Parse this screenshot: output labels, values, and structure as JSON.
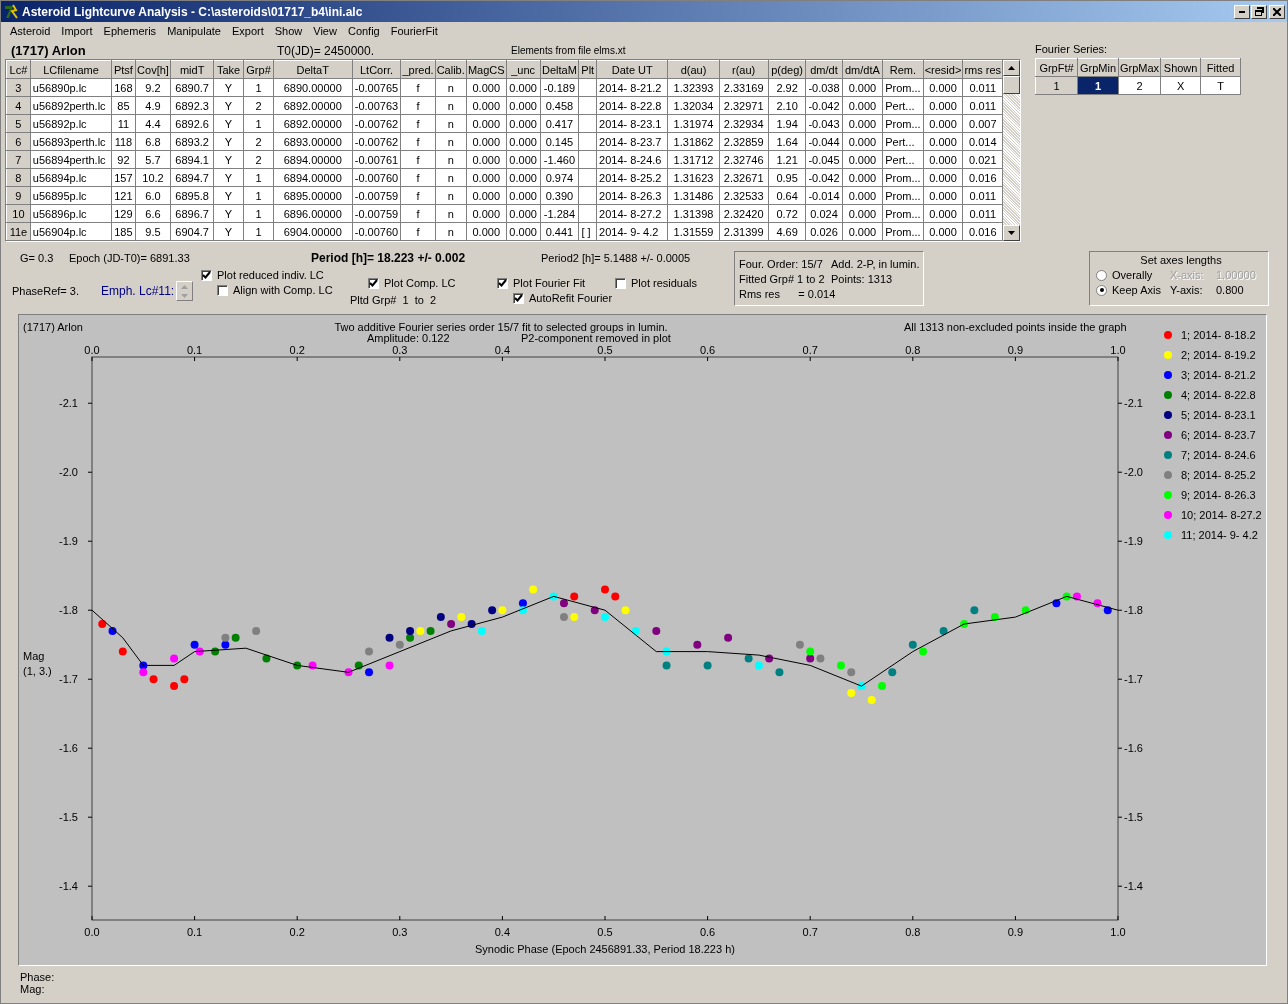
{
  "window": {
    "title": "Asteroid Lightcurve Analysis - C:\\asteroids\\01717_b4\\ini.alc"
  },
  "menu": [
    "Asteroid",
    "Import",
    "Ephemeris",
    "Manipulate",
    "Export",
    "Show",
    "View",
    "Config",
    "FourierFit"
  ],
  "header": {
    "object": "(1717) Arlon",
    "t0": "T0(JD)= 2450000.",
    "elements": "Elements from file elms.xt"
  },
  "lc_table": {
    "columns": [
      "Lc#",
      "LCfilename",
      "Ptsf",
      "Cov[h]",
      "midT",
      "Take",
      "Grp#",
      "DeltaT",
      "LtCorr.",
      "_pred.",
      "Calib.",
      "MagCS",
      "_unc",
      "DeltaM",
      "Plt",
      "Date UT",
      "d(au)",
      "r(au)",
      "p(deg)",
      "dm/dt",
      "dm/dtA",
      "Rem.",
      "<resid>",
      "rms res"
    ],
    "rows": [
      {
        "cells": [
          "3",
          "u56890p.lc",
          "168",
          "9.2",
          "6890.7",
          "Y",
          "1",
          "6890.00000",
          "-0.00765",
          "f",
          "n",
          "0.000",
          "0.000",
          "-0.189",
          "",
          "2014- 8-21.2",
          "1.32393",
          "2.33169",
          "2.92",
          "-0.038",
          "0.000",
          "Prom...",
          "0.000",
          "0.011"
        ]
      },
      {
        "cells": [
          "4",
          "u56892perth.lc",
          "85",
          "4.9",
          "6892.3",
          "Y",
          "2",
          "6892.00000",
          "-0.00763",
          "f",
          "n",
          "0.000",
          "0.000",
          "0.458",
          "",
          "2014- 8-22.8",
          "1.32034",
          "2.32971",
          "2.10",
          "-0.042",
          "0.000",
          "Pert...",
          "0.000",
          "0.011"
        ]
      },
      {
        "cells": [
          "5",
          "u56892p.lc",
          "11",
          "4.4",
          "6892.6",
          "Y",
          "1",
          "6892.00000",
          "-0.00762",
          "f",
          "n",
          "0.000",
          "0.000",
          "0.417",
          "",
          "2014- 8-23.1",
          "1.31974",
          "2.32934",
          "1.94",
          "-0.043",
          "0.000",
          "Prom...",
          "0.000",
          "0.007"
        ]
      },
      {
        "cells": [
          "6",
          "u56893perth.lc",
          "118",
          "6.8",
          "6893.2",
          "Y",
          "2",
          "6893.00000",
          "-0.00762",
          "f",
          "n",
          "0.000",
          "0.000",
          "0.145",
          "",
          "2014- 8-23.7",
          "1.31862",
          "2.32859",
          "1.64",
          "-0.044",
          "0.000",
          "Pert...",
          "0.000",
          "0.014"
        ]
      },
      {
        "cells": [
          "7",
          "u56894perth.lc",
          "92",
          "5.7",
          "6894.1",
          "Y",
          "2",
          "6894.00000",
          "-0.00761",
          "f",
          "n",
          "0.000",
          "0.000",
          "-1.460",
          "",
          "2014- 8-24.6",
          "1.31712",
          "2.32746",
          "1.21",
          "-0.045",
          "0.000",
          "Pert...",
          "0.000",
          "0.021"
        ]
      },
      {
        "cells": [
          "8",
          "u56894p.lc",
          "157",
          "10.2",
          "6894.7",
          "Y",
          "1",
          "6894.00000",
          "-0.00760",
          "f",
          "n",
          "0.000",
          "0.000",
          "0.974",
          "",
          "2014- 8-25.2",
          "1.31623",
          "2.32671",
          "0.95",
          "-0.042",
          "0.000",
          "Prom...",
          "0.000",
          "0.016"
        ]
      },
      {
        "cells": [
          "9",
          "u56895p.lc",
          "121",
          "6.0",
          "6895.8",
          "Y",
          "1",
          "6895.00000",
          "-0.00759",
          "f",
          "n",
          "0.000",
          "0.000",
          "0.390",
          "",
          "2014- 8-26.3",
          "1.31486",
          "2.32533",
          "0.64",
          "-0.014",
          "0.000",
          "Prom...",
          "0.000",
          "0.011"
        ]
      },
      {
        "cells": [
          "10",
          "u56896p.lc",
          "129",
          "6.6",
          "6896.7",
          "Y",
          "1",
          "6896.00000",
          "-0.00759",
          "f",
          "n",
          "0.000",
          "0.000",
          "-1.284",
          "",
          "2014- 8-27.2",
          "1.31398",
          "2.32420",
          "0.72",
          "0.024",
          "0.000",
          "Prom...",
          "0.000",
          "0.011"
        ]
      },
      {
        "cells": [
          "11e",
          "u56904p.lc",
          "185",
          "9.5",
          "6904.7",
          "Y",
          "1",
          "6904.00000",
          "-0.00760",
          "f",
          "n",
          "0.000",
          "0.000",
          "0.441",
          "[ ]",
          "2014- 9- 4.2",
          "1.31559",
          "2.31399",
          "4.69",
          "0.026",
          "0.000",
          "Prom...",
          "0.000",
          "0.016"
        ]
      }
    ]
  },
  "fourier_series": {
    "label": "Fourier Series:",
    "columns": [
      "GrpFt#",
      "GrpMin",
      "GrpMax",
      "Shown",
      "Fitted"
    ],
    "rows": [
      {
        "cells": [
          {
            "text": "1",
            "selected": false
          },
          {
            "text": "1",
            "selected": true
          },
          {
            "text": "2",
            "selected": false
          },
          {
            "text": "X",
            "selected": false
          },
          {
            "text": "T",
            "selected": false
          }
        ]
      }
    ]
  },
  "info": {
    "g": "G= 0.3",
    "epoch": "Epoch (JD-T0)= 6891.33",
    "period": "Period [h]= 18.223 +/- 0.002",
    "period2": "Period2 [h]= 5.1488 +/- 0.0005",
    "phase_ref": "PhaseRef= 3.",
    "emph": "Emph. Lc#11:",
    "pltd_grp": "Pltd Grp#  1  to  2"
  },
  "options": [
    {
      "label": "Plot reduced indiv. LC",
      "checked": true
    },
    {
      "label": "Align with Comp. LC",
      "checked": false
    },
    {
      "label": "Plot Comp. LC",
      "checked": true
    },
    {
      "label": "Plot Fourier Fit",
      "checked": true
    },
    {
      "label": "AutoRefit Fourier",
      "checked": true
    },
    {
      "label": "Plot residuals",
      "checked": false
    }
  ],
  "fit_summary": [
    "Four. Order: 15/7",
    "Add. 2-P, in lumin.",
    "Fitted Grp# 1 to 2",
    "Points: 1313",
    "Rms res      = 0.014"
  ],
  "axes": {
    "title": "Set axes lengths",
    "modes": [
      {
        "label": "Overally",
        "selected": false
      },
      {
        "label": "Keep Axis",
        "selected": true
      }
    ],
    "fields": [
      {
        "label": "X-axis:",
        "value": "1.00000",
        "disabled": true
      },
      {
        "label": "Y-axis:",
        "value": "0.800",
        "disabled": false
      }
    ]
  },
  "plot": {
    "object": "(1717) Arlon",
    "title": "Two additive Fourier series order 15/7 fit to selected groups in lumin.",
    "amplitude": "Amplitude: 0.122",
    "note": "P2-component removed in plot",
    "count": "All 1313 non-excluded points inside the graph",
    "ylabel_sub": "(1, 3.)",
    "top_axis_labels": [
      "0.0",
      "0.1",
      "0.2",
      "0.3",
      "0.4",
      "0.5",
      "0.6",
      "0.7",
      "0.8",
      "0.9",
      "1.0"
    ],
    "right_axis_labels": [
      "-2.1",
      "-2.0",
      "-1.9",
      "-1.8",
      "-1.7",
      "-1.6",
      "-1.5",
      "-1.4"
    ],
    "chart_data": {
      "type": "scatter",
      "legend": "right",
      "xlabel": "Synodic Phase (Epoch 2456891.33, Period 18.223 h)",
      "ylabel": "Mag",
      "xlim": [
        0,
        1
      ],
      "ylim": [
        -1.351,
        -2.167
      ],
      "xticks": [
        {
          "value": 0,
          "label": "0.0"
        },
        {
          "value": 0.1,
          "label": "0.1"
        },
        {
          "value": 0.2,
          "label": "0.2"
        },
        {
          "value": 0.3,
          "label": "0.3"
        },
        {
          "value": 0.4,
          "label": "0.4"
        },
        {
          "value": 0.5,
          "label": "0.5"
        },
        {
          "value": 0.6,
          "label": "0.6"
        },
        {
          "value": 0.7,
          "label": "0.7"
        },
        {
          "value": 0.8,
          "label": "0.8"
        },
        {
          "value": 0.9,
          "label": "0.9"
        },
        {
          "value": 1,
          "label": "1.0"
        }
      ],
      "yticks": [
        {
          "value": -2.1,
          "label": "-2.1"
        },
        {
          "value": -2,
          "label": "-2.0"
        },
        {
          "value": -1.9,
          "label": "-1.9"
        },
        {
          "value": -1.8,
          "label": "-1.8"
        },
        {
          "value": -1.7,
          "label": "-1.7"
        },
        {
          "value": -1.6,
          "label": "-1.6"
        },
        {
          "value": -1.5,
          "label": "-1.5"
        },
        {
          "value": -1.4,
          "label": "-1.4"
        }
      ],
      "series": [
        {
          "name": "1; 2014- 8-18.2",
          "color": "#ff0000",
          "x": [
            0.01,
            0.03,
            0.06,
            0.08,
            0.09,
            0.47,
            0.5,
            0.51
          ],
          "values": [
            -1.78,
            -1.74,
            -1.7,
            -1.69,
            -1.7,
            -1.82,
            -1.83,
            -1.82
          ]
        },
        {
          "name": "2; 2014- 8-19.2",
          "color": "#ffff00",
          "x": [
            0.32,
            0.36,
            0.4,
            0.43,
            0.47,
            0.52,
            0.74,
            0.76
          ],
          "values": [
            -1.77,
            -1.79,
            -1.8,
            -1.83,
            -1.79,
            -1.8,
            -1.68,
            -1.67
          ]
        },
        {
          "name": "3; 2014- 8-21.2",
          "color": "#0000ff",
          "x": [
            0.02,
            0.05,
            0.1,
            0.13,
            0.27,
            0.42,
            0.94,
            0.99
          ],
          "values": [
            -1.77,
            -1.72,
            -1.75,
            -1.75,
            -1.71,
            -1.81,
            -1.81,
            -1.8
          ]
        },
        {
          "name": "4; 2014- 8-22.8",
          "color": "#008000",
          "x": [
            0.12,
            0.14,
            0.17,
            0.2,
            0.26,
            0.31,
            0.33
          ],
          "values": [
            -1.74,
            -1.76,
            -1.73,
            -1.72,
            -1.72,
            -1.76,
            -1.77
          ]
        },
        {
          "name": "5; 2014- 8-23.1",
          "color": "#000080",
          "x": [
            0.29,
            0.31,
            0.34,
            0.37,
            0.39
          ],
          "values": [
            -1.76,
            -1.77,
            -1.79,
            -1.78,
            -1.8
          ]
        },
        {
          "name": "6; 2014- 8-23.7",
          "color": "#800080",
          "x": [
            0.35,
            0.46,
            0.49,
            0.55,
            0.59,
            0.62,
            0.66,
            0.7
          ],
          "values": [
            -1.78,
            -1.81,
            -1.8,
            -1.77,
            -1.75,
            -1.76,
            -1.73,
            -1.73
          ]
        },
        {
          "name": "7; 2014- 8-24.6",
          "color": "#008080",
          "x": [
            0.56,
            0.6,
            0.64,
            0.67,
            0.78,
            0.8,
            0.83,
            0.86
          ],
          "values": [
            -1.72,
            -1.72,
            -1.73,
            -1.71,
            -1.71,
            -1.75,
            -1.77,
            -1.8
          ]
        },
        {
          "name": "8; 2014- 8-25.2",
          "color": "#808080",
          "x": [
            0.13,
            0.16,
            0.27,
            0.3,
            0.46,
            0.69,
            0.71,
            0.74
          ],
          "values": [
            -1.76,
            -1.77,
            -1.74,
            -1.75,
            -1.79,
            -1.75,
            -1.73,
            -1.71
          ]
        },
        {
          "name": "9; 2014- 8-26.3",
          "color": "#00ff00",
          "x": [
            0.7,
            0.73,
            0.77,
            0.81,
            0.85,
            0.88,
            0.91,
            0.95
          ],
          "values": [
            -1.74,
            -1.72,
            -1.69,
            -1.74,
            -1.78,
            -1.79,
            -1.8,
            -1.82
          ]
        },
        {
          "name": "10; 2014- 8-27.2",
          "color": "#ff00ff",
          "x": [
            0.05,
            0.08,
            0.105,
            0.215,
            0.25,
            0.29,
            0.96,
            0.98
          ],
          "values": [
            -1.71,
            -1.73,
            -1.74,
            -1.72,
            -1.71,
            -1.72,
            -1.82,
            -1.81
          ]
        },
        {
          "name": "11; 2014- 9- 4.2",
          "color": "#00ffff",
          "x": [
            0.38,
            0.42,
            0.45,
            0.5,
            0.53,
            0.56,
            0.65,
            0.75
          ],
          "values": [
            -1.77,
            -1.8,
            -1.82,
            -1.79,
            -1.77,
            -1.74,
            -1.72,
            -1.69
          ]
        },
        {
          "type": "line",
          "color": "#000000",
          "x": [
            0,
            0.03,
            0.05,
            0.08,
            0.1,
            0.15,
            0.2,
            0.25,
            0.3,
            0.35,
            0.4,
            0.45,
            0.5,
            0.55,
            0.6,
            0.65,
            0.7,
            0.75,
            0.8,
            0.85,
            0.9,
            0.95,
            1
          ],
          "values": [
            -1.8,
            -1.76,
            -1.72,
            -1.72,
            -1.74,
            -1.745,
            -1.72,
            -1.71,
            -1.74,
            -1.77,
            -1.79,
            -1.82,
            -1.8,
            -1.74,
            -1.74,
            -1.735,
            -1.72,
            -1.69,
            -1.74,
            -1.78,
            -1.79,
            -1.82,
            -1.8
          ]
        }
      ]
    }
  },
  "status": [
    "Phase:",
    "Mag:"
  ]
}
